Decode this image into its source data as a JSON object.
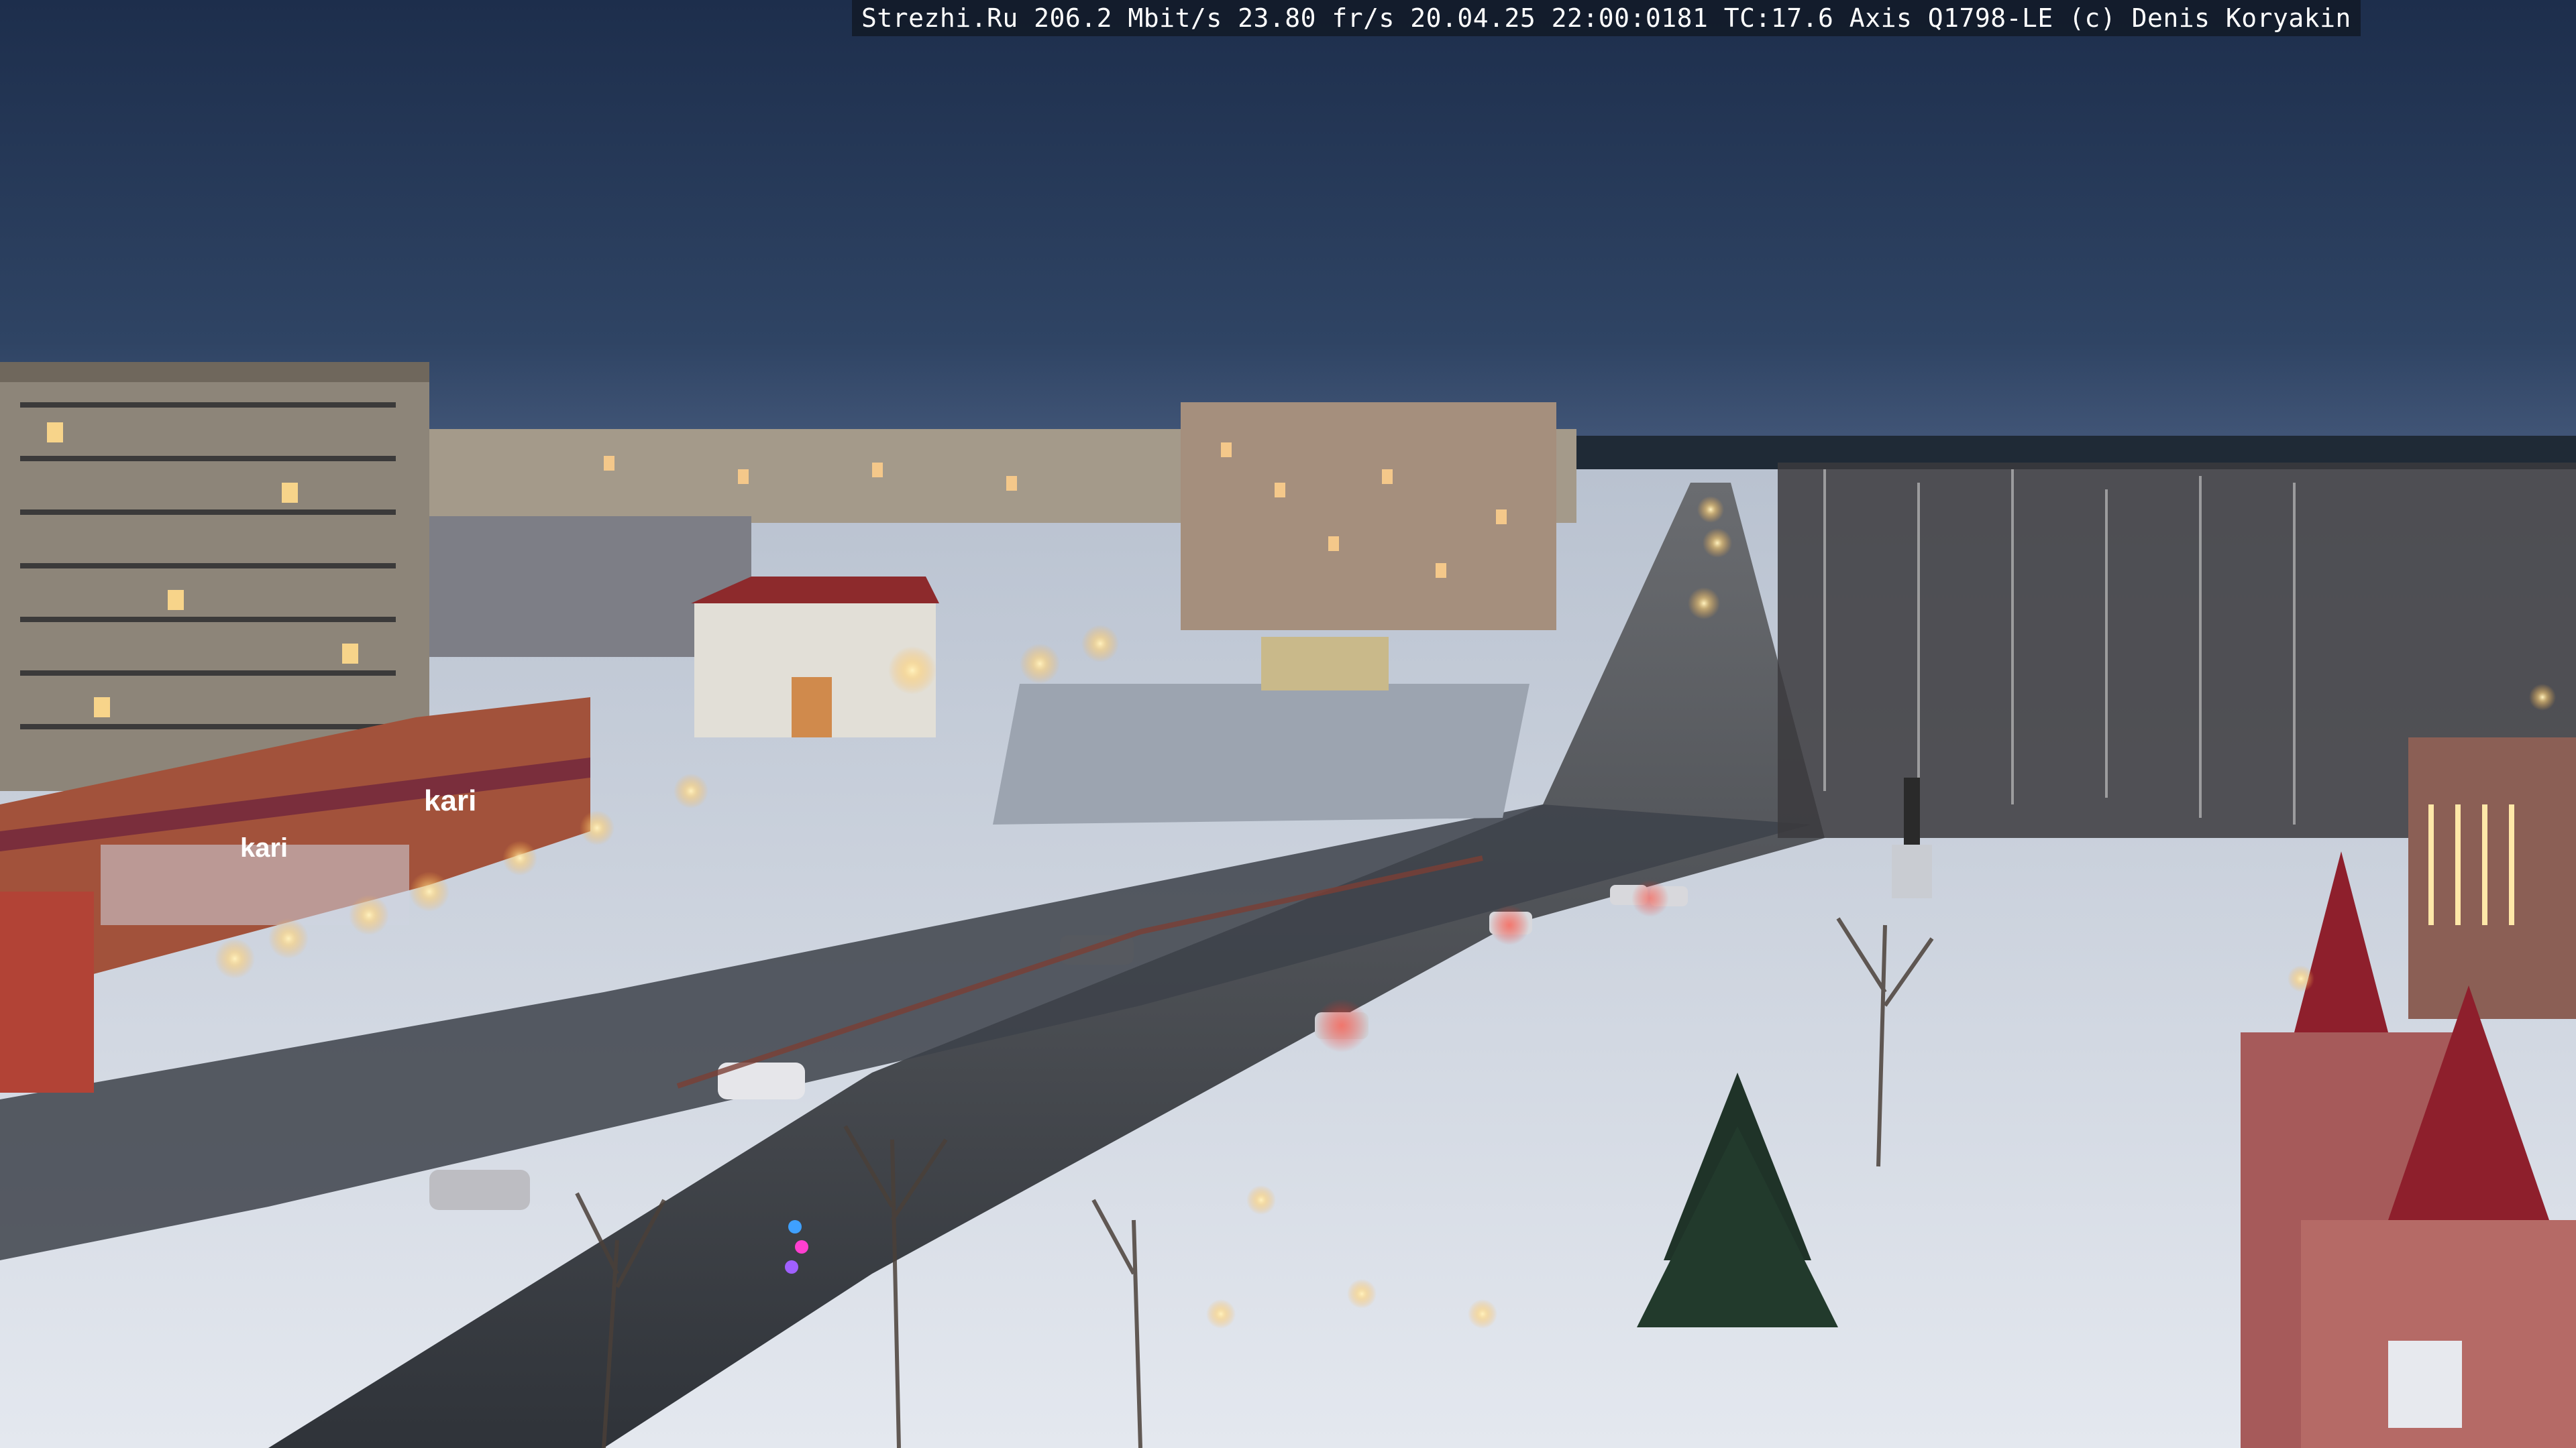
{
  "camera_overlay": {
    "text": "Strezhi.Ru 206.2 Mbit/s 23.80 fr/s 20.04.25 22:00:0181 TC:17.6  Axis Q1798-LE  (c) Denis Koryakin"
  },
  "signs": {
    "kari_main": "kari",
    "kari_secondary": "kari"
  },
  "colors": {
    "sky_top": "#1e3050",
    "sky_horizon": "#3a5070",
    "snow": "#d8dde6",
    "road": "#3a3f48",
    "building_panel": "#8c8478",
    "storefront": "#a0503a",
    "street_light": "#ffd98a"
  }
}
